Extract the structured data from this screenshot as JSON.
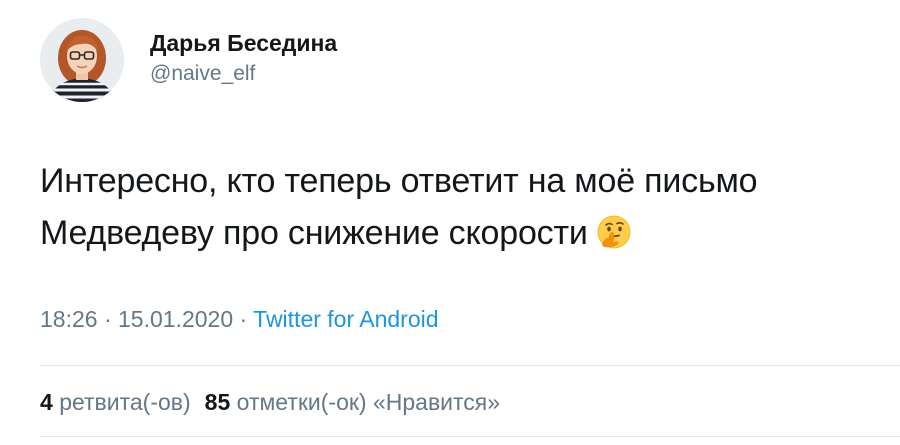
{
  "author": {
    "display_name": "Дарья Беседина",
    "handle": "@naive_elf"
  },
  "tweet": {
    "line1": "Интересно, кто теперь ответит на моё письмо",
    "line2": "Медведеву про снижение скорости",
    "emoji": "thinking-face"
  },
  "meta": {
    "time": "18:26",
    "separator1": " · ",
    "date": "15.01.2020",
    "separator2": " · ",
    "source": "Twitter for Android"
  },
  "stats": {
    "retweets_count": "4",
    "retweets_label": "ретвита(-ов)",
    "likes_count": "85",
    "likes_label": "отметки(-ок) «Нравится»"
  },
  "colors": {
    "text": "#14171a",
    "secondary": "#657786",
    "link": "#1b95e0",
    "divider": "#e1e8ed"
  }
}
